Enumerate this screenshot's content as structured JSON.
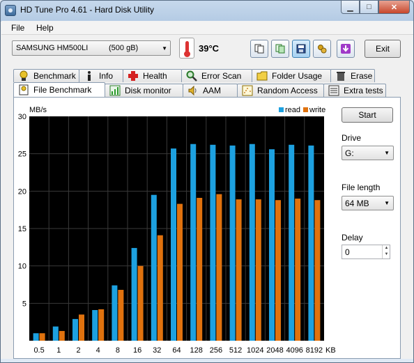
{
  "window": {
    "title": "HD Tune Pro 4.61 - Hard Disk Utility"
  },
  "menu": {
    "file": "File",
    "help": "Help"
  },
  "toolbar": {
    "drive_name": "SAMSUNG HM500LI",
    "drive_size": "(500 gB)",
    "temperature": "39°C",
    "exit_label": "Exit",
    "icons": [
      "copy-info-icon",
      "copy-screenshot-icon",
      "save-icon",
      "options-icon",
      "download-icon"
    ]
  },
  "tabs_top": [
    {
      "label": "Benchmark",
      "icon": "medal-icon"
    },
    {
      "label": "Info",
      "icon": "info-icon"
    },
    {
      "label": "Health",
      "icon": "health-cross-icon"
    },
    {
      "label": "Error Scan",
      "icon": "magnifier-icon"
    },
    {
      "label": "Folder Usage",
      "icon": "folder-icon"
    },
    {
      "label": "Erase",
      "icon": "trash-icon"
    }
  ],
  "tabs_bottom": [
    {
      "label": "File Benchmark",
      "icon": "file-benchmark-icon",
      "active": true
    },
    {
      "label": "Disk monitor",
      "icon": "disk-monitor-icon"
    },
    {
      "label": "AAM",
      "icon": "speaker-icon"
    },
    {
      "label": "Random Access",
      "icon": "random-access-icon"
    },
    {
      "label": "Extra tests",
      "icon": "extra-tests-icon"
    }
  ],
  "panel": {
    "start_label": "Start",
    "drive_label": "Drive",
    "drive_value": "G:",
    "file_length_label": "File length",
    "file_length_value": "64 MB",
    "delay_label": "Delay",
    "delay_value": "0"
  },
  "chart_data": {
    "type": "bar",
    "ylabel": "MB/s",
    "x_unit": "KB",
    "ylim": [
      0,
      30
    ],
    "yticks": [
      5,
      10,
      15,
      20,
      25,
      30
    ],
    "grid": true,
    "legend": "top-right",
    "categories": [
      "0.5",
      "1",
      "2",
      "4",
      "8",
      "16",
      "32",
      "64",
      "128",
      "256",
      "512",
      "1024",
      "2048",
      "4096",
      "8192"
    ],
    "series": [
      {
        "name": "read",
        "color": "#1da1e0",
        "values": [
          1.0,
          1.9,
          2.9,
          4.1,
          7.4,
          12.4,
          19.5,
          25.7,
          26.3,
          26.2,
          26.1,
          26.3,
          25.6,
          26.2,
          26.1
        ]
      },
      {
        "name": "write",
        "color": "#e0720e",
        "values": [
          1.0,
          1.3,
          3.5,
          4.2,
          6.8,
          10.0,
          14.1,
          18.3,
          19.1,
          19.6,
          18.9,
          18.9,
          18.8,
          19.0,
          18.8
        ]
      }
    ]
  }
}
